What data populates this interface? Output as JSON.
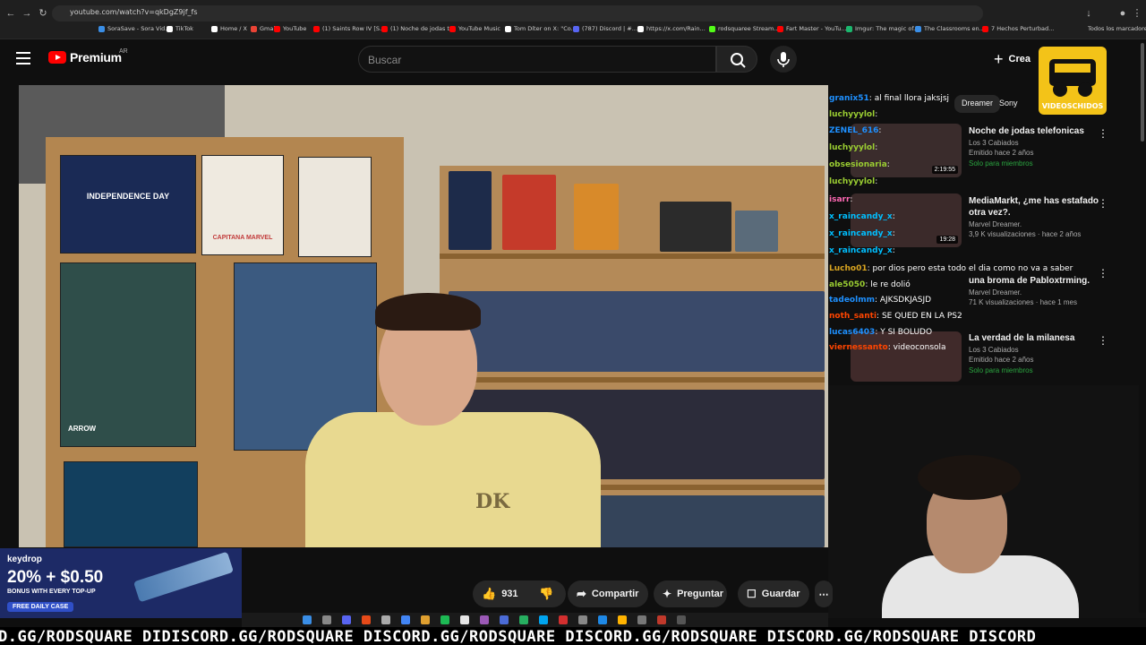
{
  "browser": {
    "url": "youtube.com/watch?v=qkDgZ9jf_fs",
    "bookmarks": [
      {
        "label": "SoraSave - Sora Vid...",
        "color": "#3a8ee6"
      },
      {
        "label": "TikTok",
        "color": "#ffffff"
      },
      {
        "label": "Home / X",
        "color": "#ffffff"
      },
      {
        "label": "Gmail",
        "color": "#ea4335"
      },
      {
        "label": "YouTube",
        "color": "#ff0000"
      },
      {
        "label": "(1) Saints Row IV [S...",
        "color": "#ff0000"
      },
      {
        "label": "(1) Noche de jodas t...",
        "color": "#ff0000"
      },
      {
        "label": "YouTube Music",
        "color": "#ff0000"
      },
      {
        "label": "Tom Díter on X: \"Co...",
        "color": "#ffffff"
      },
      {
        "label": "(787) Discord | #...",
        "color": "#5865f2"
      },
      {
        "label": "https://x.com/Rain...",
        "color": "#ffffff"
      },
      {
        "label": "rodsquaree Stream...",
        "color": "#53fc18"
      },
      {
        "label": "Fart Master - YouTu...",
        "color": "#ff0000"
      },
      {
        "label": "Imgur: The magic of...",
        "color": "#1bb76e"
      },
      {
        "label": "The Classrooms en...",
        "color": "#3a8ee6"
      },
      {
        "label": "7 Hechos Perturbad...",
        "color": "#ff0000"
      }
    ],
    "bookmarks_folder": "Todos los marcadores"
  },
  "header": {
    "logo_text": "Premium",
    "country": "AR",
    "search_placeholder": "Buscar",
    "create_label": "Crea"
  },
  "video": {
    "shirt_logo": "DK",
    "poster_independence": "INDEPENDENCE DAY",
    "poster_capitana": "CAPITANA MARVEL",
    "poster_arrow": "ARROW"
  },
  "chat": [
    {
      "user": "granix51",
      "msg": "al final llora jaksjsj",
      "color": "#1e90ff"
    },
    {
      "user": "luchyyylol",
      "msg": "",
      "color": "#9acd32"
    },
    {
      "user": "ZENEL_616",
      "msg": "",
      "color": "#1e90ff"
    },
    {
      "user": "luchyyylol",
      "msg": "",
      "color": "#9acd32"
    },
    {
      "user": "obsesionaria",
      "msg": "",
      "color": "#9acd32"
    },
    {
      "user": "luchyyylol",
      "msg": "",
      "color": "#9acd32"
    },
    {
      "user": "isarr",
      "msg": "",
      "color": "#ff69b4"
    },
    {
      "user": "x_raincandy_x",
      "msg": "",
      "color": "#00bfff"
    },
    {
      "user": "x_raincandy_x",
      "msg": "",
      "color": "#00bfff"
    },
    {
      "user": "x_raincandy_x",
      "msg": "",
      "color": "#00bfff"
    },
    {
      "user": "Lucho01",
      "msg": "por dios pero esta todo el dia como no va a saber",
      "color": "#daa520"
    },
    {
      "user": "ale5050",
      "msg": "le re dolió",
      "color": "#9acd32"
    },
    {
      "user": "tadeolmm",
      "msg": "AJKSDKJASJD",
      "color": "#1e90ff"
    },
    {
      "user": "noth_santi",
      "msg": "SE QUED EN LA PS2",
      "color": "#ff4500"
    },
    {
      "user": "lucas6403",
      "msg": "Y SI BOLUDO",
      "color": "#1e90ff"
    },
    {
      "user": "viernessanto",
      "msg": "videoconsola",
      "color": "#ff4500"
    }
  ],
  "rail": {
    "chips": [
      "Dreamer",
      "Sony"
    ],
    "recommendations": [
      {
        "title": "Noche de jodas telefonicas",
        "channel": "Los 3 Cabiados",
        "meta": "Emitido hace 2 años",
        "members": "Solo para miembros",
        "duration": "2:19:55"
      },
      {
        "title": "MediaMarkt, ¿me has estafado otra vez?.",
        "channel": "Marvel Dreamer.",
        "meta": "3,9 K visualizaciones · hace 2 años",
        "members": "",
        "duration": "19:28"
      },
      {
        "title": "una broma de Pabloxtrming.",
        "channel": "Marvel Dreamer.",
        "meta": "71 K visualizaciones · hace 1 mes",
        "members": "",
        "duration": ""
      },
      {
        "title": "La verdad de la milanesa",
        "channel": "Los 3 Cabiados",
        "meta": "Emitido hace 2 años",
        "members": "Solo para miembros",
        "duration": ""
      }
    ]
  },
  "watermark": {
    "text": "VIDEOSCHIDOS"
  },
  "actions": {
    "likes": "931",
    "share": "Compartir",
    "ask": "Preguntar",
    "save": "Guardar"
  },
  "ad": {
    "brand": "keydrop",
    "headline": "20% + $0.50",
    "sub": "BONUS WITH EVERY TOP-UP",
    "cta": "FREE DAILY CASE"
  },
  "ticker": {
    "text": "D.GG/RODSQUARE DIDISCORD.GG/RODSQUARE DISCORD.GG/RODSQUARE DISCORD.GG/RODSQUARE DISCORD.GG/RODSQUARE DISCORD"
  }
}
